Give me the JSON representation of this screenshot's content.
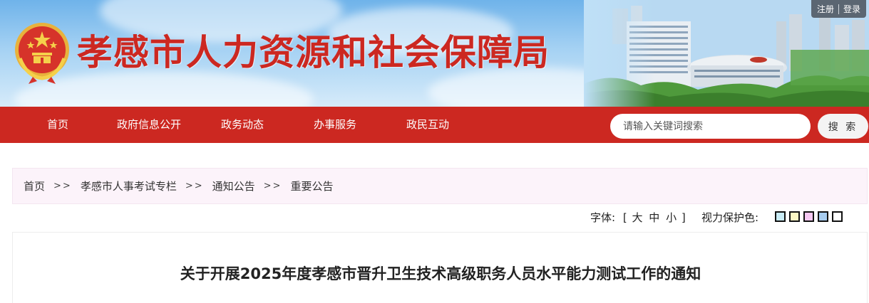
{
  "header": {
    "site_title": "孝感市人力资源和社会保障局",
    "auth": {
      "register": "注册",
      "login": "登录"
    },
    "emblem": "national-emblem-icon"
  },
  "nav": {
    "items": [
      {
        "label": "首页"
      },
      {
        "label": "政府信息公开"
      },
      {
        "label": "政务动态"
      },
      {
        "label": "办事服务"
      },
      {
        "label": "政民互动"
      }
    ],
    "search": {
      "placeholder": "请输入关键词搜索",
      "value": "",
      "button": "搜 索"
    }
  },
  "breadcrumb": {
    "items": [
      "首页",
      "孝感市人事考试专栏",
      "通知公告",
      "重要公告"
    ],
    "separator": ">>"
  },
  "tools": {
    "font_label": "字体:",
    "font_open": "[",
    "font_close": "]",
    "font_options": [
      "大",
      "中",
      "小"
    ],
    "eye_label": "视力保护色:",
    "eye_colors": [
      "#c9ecf6",
      "#fbf6c4",
      "#f6c8f2",
      "#a8cdf0",
      "#ffffff"
    ]
  },
  "article": {
    "title": "关于开展2025年度孝感市晋升卫生技术高级职务人员水平能力测试工作的通知"
  },
  "colors": {
    "brand": "#cc2821",
    "breadcrumb_bg": "#fcf3fa"
  }
}
